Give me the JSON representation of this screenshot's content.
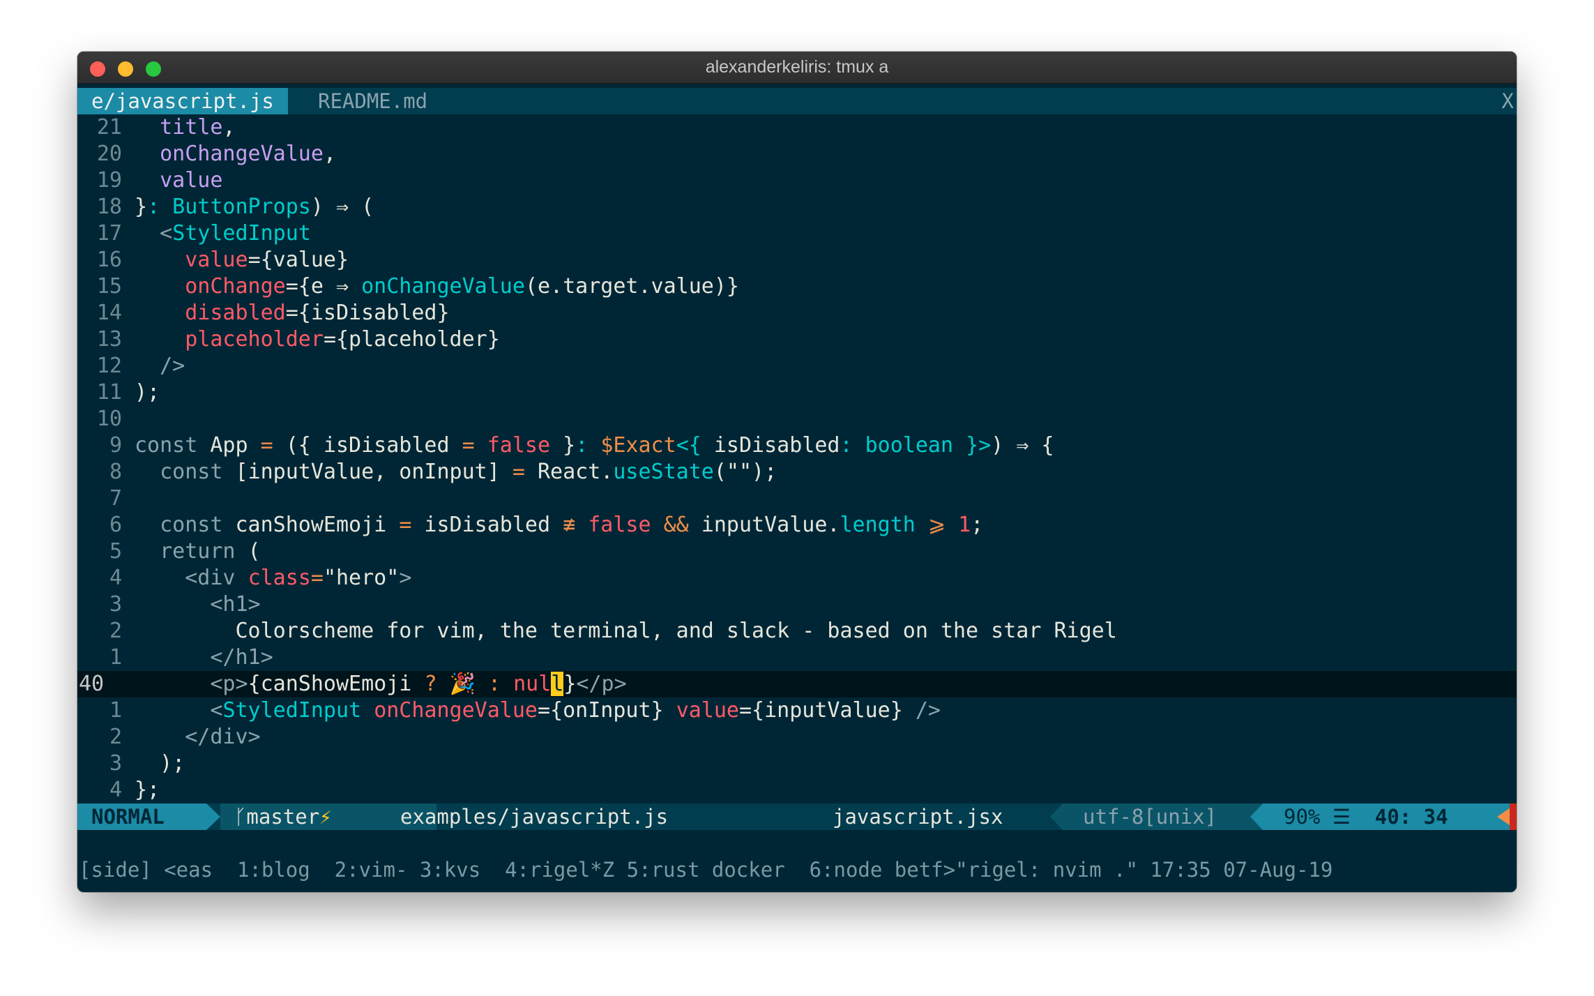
{
  "window": {
    "title": "alexanderkeliris: tmux a"
  },
  "tabs": [
    {
      "label": "e/javascript.js",
      "active": true
    },
    {
      "label": "README.md",
      "active": false
    }
  ],
  "close_tab_glyph": "X",
  "code_lines": [
    {
      "num": "21",
      "html": "  <span class='p'>title</span>,"
    },
    {
      "num": "20",
      "html": "  <span class='p'>onChangeValue</span>,"
    },
    {
      "num": "19",
      "html": "  <span class='p'>value</span>"
    },
    {
      "num": "18",
      "html": "}<span class='c'>: ButtonProps</span>) ⇒ ("
    },
    {
      "num": "17",
      "html": "  <span class='g'>&lt;</span><span class='c'>StyledInput</span>"
    },
    {
      "num": "16",
      "html": "    <span class='r'>value</span>={value}"
    },
    {
      "num": "15",
      "html": "    <span class='r'>onChange</span>={e ⇒ <span class='c'>onChangeValue</span>(e.target.value)}"
    },
    {
      "num": "14",
      "html": "    <span class='r'>disabled</span>={isDisabled}"
    },
    {
      "num": "13",
      "html": "    <span class='r'>placeholder</span>={placeholder}"
    },
    {
      "num": "12",
      "html": "  <span class='g'>/&gt;</span>"
    },
    {
      "num": "11",
      "html": ");"
    },
    {
      "num": "10",
      "html": ""
    },
    {
      "num": "9",
      "html": "<span class='g'>const</span> App <span class='o'>=</span> ({ isDisabled <span class='o'>=</span> <span class='r'>false</span> }<span class='c'>:</span> <span class='o'>$Exact</span><span class='c'>&lt;{</span> isDisabled<span class='c'>: boolean }&gt;</span>) ⇒ {"
    },
    {
      "num": "8",
      "html": "  <span class='g'>const</span> [inputValue, onInput] <span class='o'>=</span> React.<span class='c'>useState</span>(\"\");"
    },
    {
      "num": "7",
      "html": ""
    },
    {
      "num": "6",
      "html": "  <span class='g'>const</span> canShowEmoji <span class='o'>=</span> isDisabled <span class='o'>≢</span> <span class='r'>false</span> <span class='o'>&amp;&amp;</span> inputValue.<span class='c'>length</span> <span class='o'>⩾</span> <span class='r'>1</span>;"
    },
    {
      "num": "5",
      "html": "  <span class='g'>return</span> ("
    },
    {
      "num": "4",
      "html": "    <span class='g'>&lt;div</span> <span class='r'>class</span><span class='o'>=</span><span class='w'>\"hero\"</span><span class='g'>&gt;</span>"
    },
    {
      "num": "3",
      "html": "      <span class='g'>&lt;h1&gt;</span>"
    },
    {
      "num": "2",
      "html": "        Colorscheme for vim, the terminal, and slack - based on the star Rigel"
    },
    {
      "num": "1",
      "html": "      <span class='g'>&lt;/h1&gt;</span>"
    },
    {
      "num": "40",
      "current": true,
      "html": "      <span class='g'>&lt;p&gt;</span>{canShowEmoji <span class='o'>?</span> <span class='y'>🎉</span> <span class='o'>:</span> <span class='r'>nul</span><span class='cursor'>l</span>}<span class='g'>&lt;/p&gt;</span>"
    },
    {
      "num": "1",
      "html": "      <span class='g'>&lt;</span><span class='c'>StyledInput</span> <span class='r'>onChangeValue</span>={onInput} <span class='r'>value</span>={inputValue} <span class='g'>/&gt;</span>"
    },
    {
      "num": "2",
      "html": "    <span class='g'>&lt;/div&gt;</span>"
    },
    {
      "num": "3",
      "html": "  );"
    },
    {
      "num": "4",
      "html": "};"
    }
  ],
  "statusline": {
    "mode": "NORMAL",
    "branch_icon": "ᚴ",
    "branch": "master",
    "branch_flag": "⚡",
    "file": "examples/javascript.js",
    "filetype": "javascript.jsx",
    "encoding": "utf-8[unix]",
    "percent": "90%",
    "percent_icon": "☰",
    "position": "40: 34"
  },
  "tmux_status": "[side] <eas  1:blog  2:vim- 3:kvs  4:rigel*Z 5:rust docker  6:node betf>\"rigel: nvim .\" 17:35 07-Aug-19",
  "colors": {
    "background": "#002635",
    "accent": "#1b8ba6",
    "red": "#ff5a67",
    "orange": "#f08e48",
    "cyan": "#00cccc",
    "yellow": "#ffcc1b"
  }
}
